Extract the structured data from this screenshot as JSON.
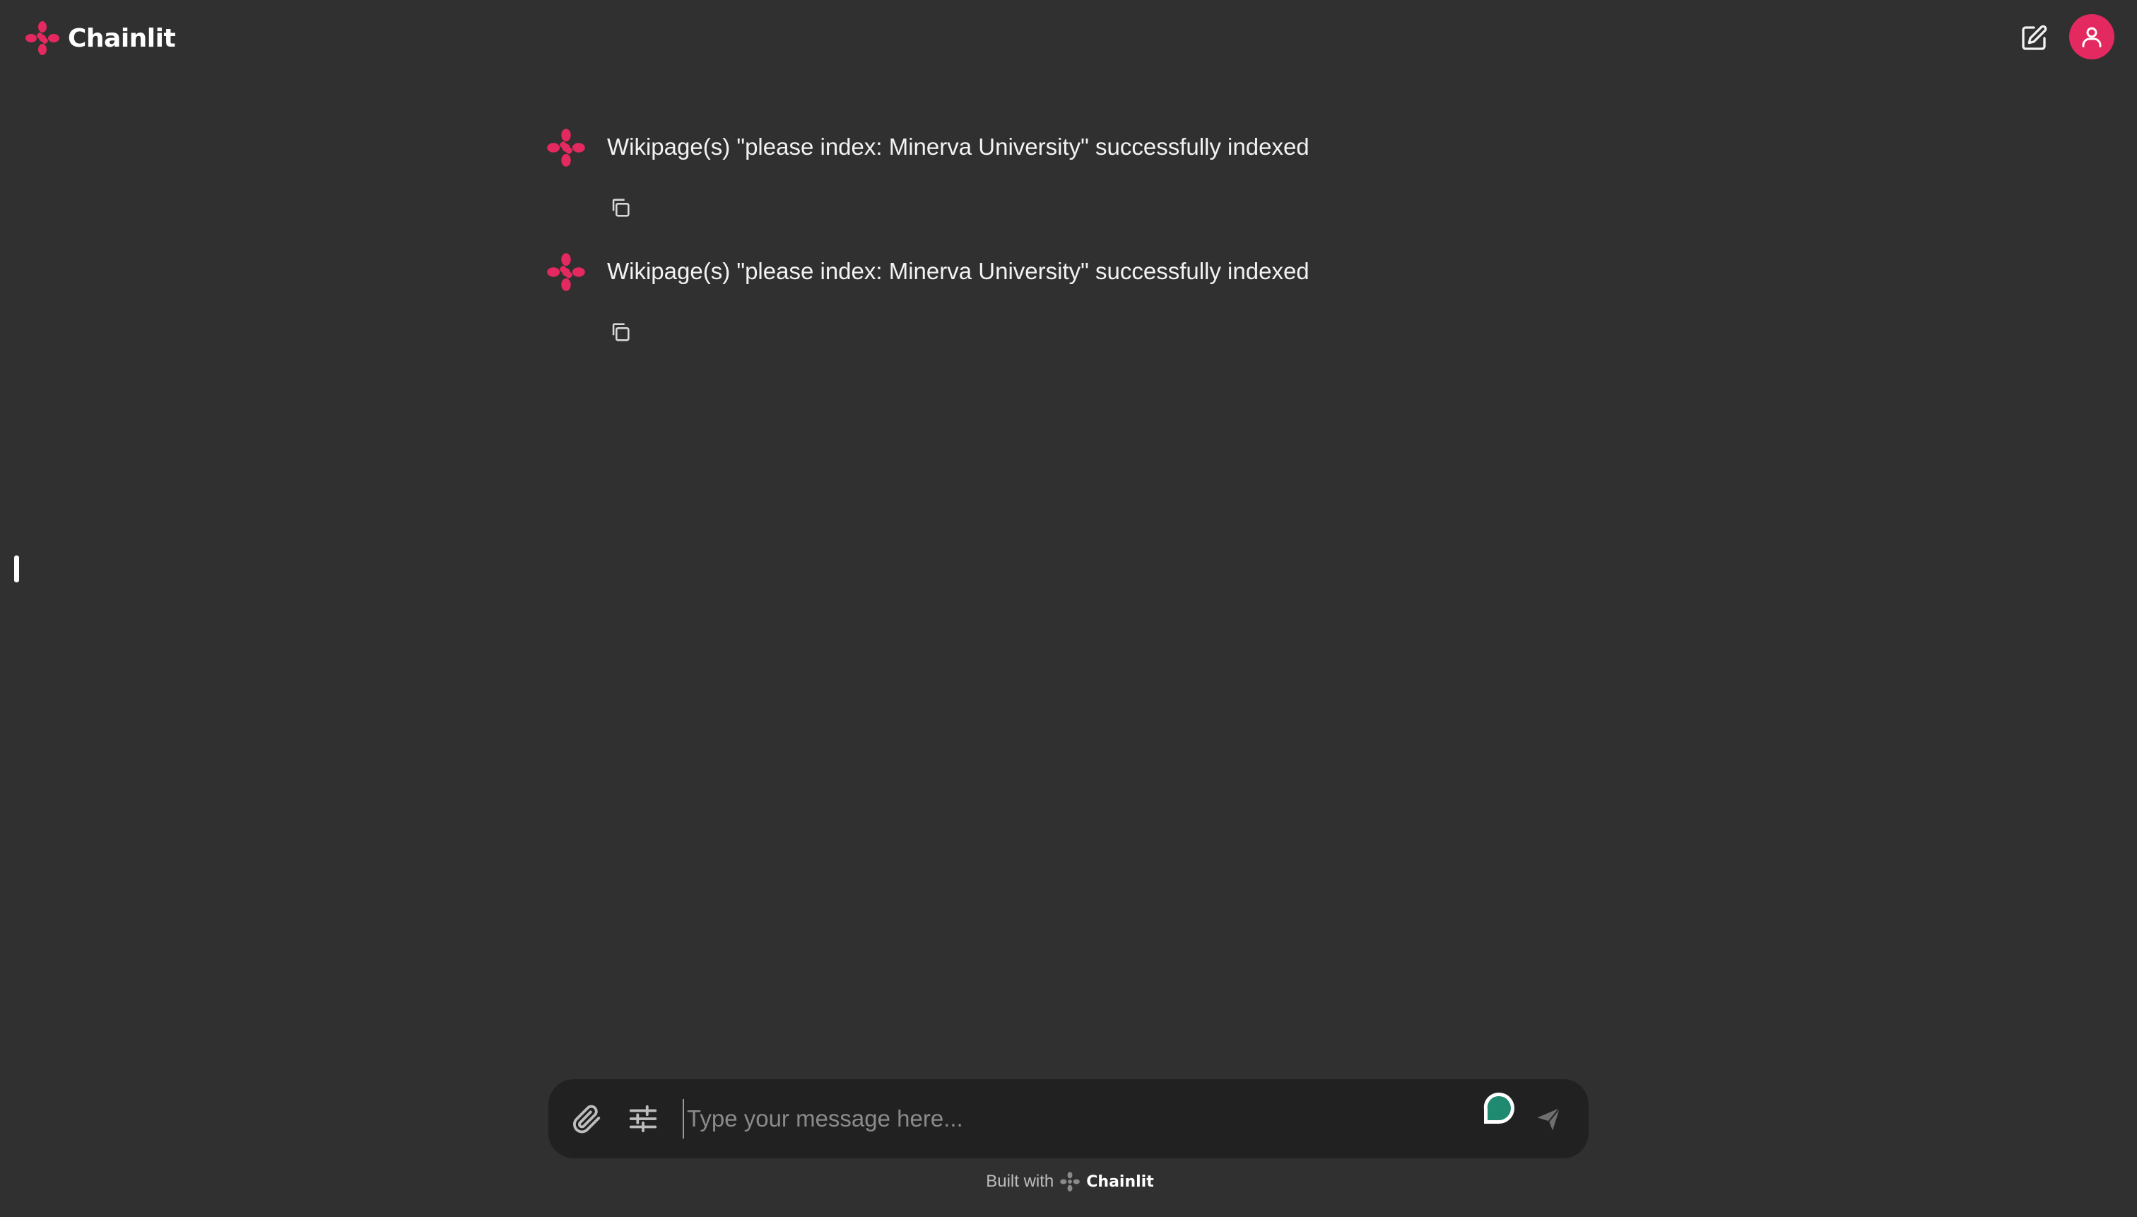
{
  "app": {
    "name": "Chainlit"
  },
  "header": {
    "new_chat_icon": "pencil-square-icon",
    "user_icon": "user-icon"
  },
  "messages": [
    {
      "author_icon": "chainlit-logo-icon",
      "text": "Wikipage(s) \"please index: Minerva University\" successfully indexed",
      "action_icon": "copy-icon"
    },
    {
      "author_icon": "chainlit-logo-icon",
      "text": "Wikipage(s) \"please index: Minerva University\" successfully indexed",
      "action_icon": "copy-icon"
    }
  ],
  "composer": {
    "placeholder": "Type your message here...",
    "value": "",
    "attach_icon": "paperclip-icon",
    "settings_icon": "sliders-icon",
    "widget_icon": "chat-bubble-icon",
    "send_icon": "send-icon"
  },
  "footer": {
    "built_with": "Built with",
    "brand": "Chainlit"
  },
  "colors": {
    "background": "#303030",
    "composer_background": "#212121",
    "accent": "#e3295f",
    "widget": "#1f8a70"
  }
}
